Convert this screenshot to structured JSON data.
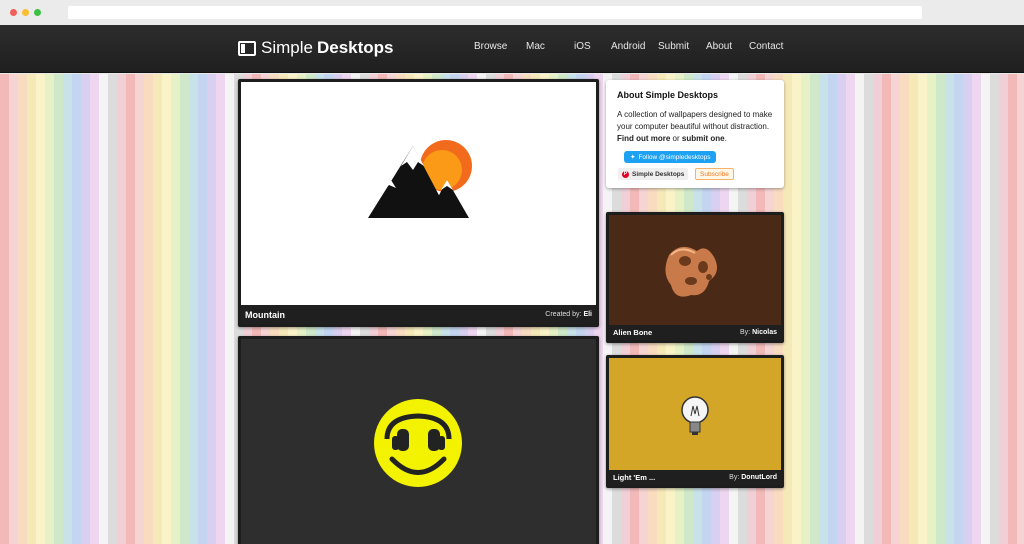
{
  "site": {
    "logo_light": "Simple",
    "logo_bold": "Desktops"
  },
  "nav": {
    "items": [
      "Browse",
      "Mac",
      "iOS",
      "Android",
      "Submit",
      "About",
      "Contact"
    ]
  },
  "about": {
    "heading": "About Simple Desktops",
    "text_1": "A collection of wallpapers designed to make your computer beautiful without distraction.",
    "link_find": "Find out more",
    "text_or": " or ",
    "link_submit": "submit one",
    "text_end": ".",
    "twitter_label": "Follow @simpledesktops",
    "pinterest_label": "Simple Desktops",
    "subscribe_label": "Subscribe"
  },
  "wallpapers": [
    {
      "title": "Mountain",
      "by_label": "Created by:",
      "author": "Eli",
      "bg": "#ffffff"
    },
    {
      "title": "",
      "by_label": "",
      "author": "",
      "bg": "#2e2e2e"
    },
    {
      "title": "Alien Bone",
      "by_label": "By:",
      "author": "Nicolas",
      "bg": "#4a2a16"
    },
    {
      "title": "Light 'Em ...",
      "by_label": "By:",
      "author": "DonutLord",
      "bg": "#d4a628"
    }
  ],
  "colors": {
    "header_bg": "#232323",
    "twitter": "#1da1f2",
    "pinterest": "#e60023",
    "subscribe": "#f07a1e"
  }
}
